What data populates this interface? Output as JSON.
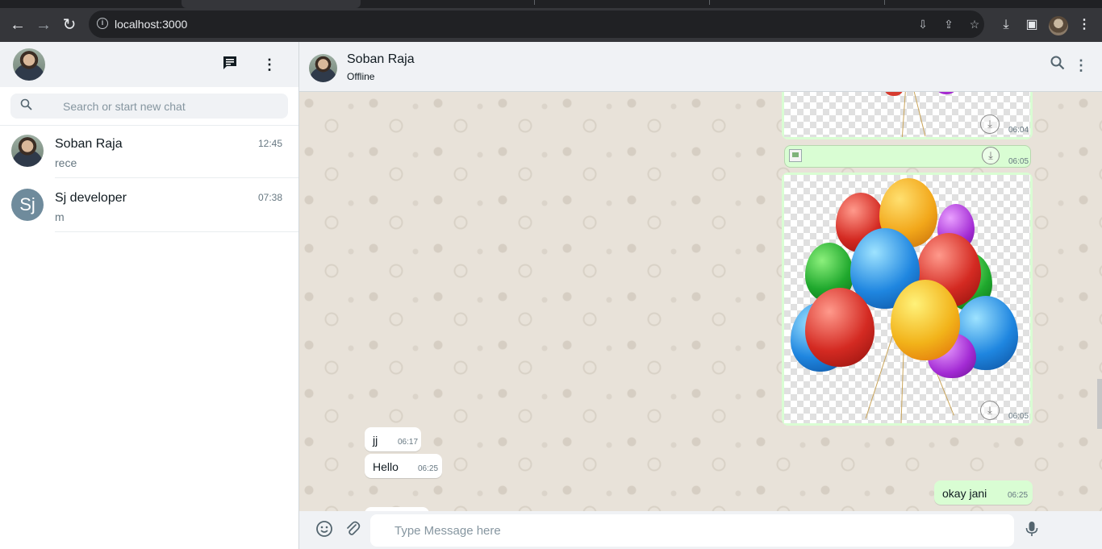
{
  "browser": {
    "url": "localhost:3000",
    "icons": [
      "back-icon",
      "forward-icon",
      "reload-icon",
      "info-icon",
      "install-icon",
      "share-icon",
      "star-icon",
      "download-icon",
      "sidepanel-icon",
      "menu-icon"
    ]
  },
  "sidebar": {
    "search_placeholder": "Search or start new chat",
    "chats": [
      {
        "name": "Soban Raja",
        "last": "rece",
        "time": "12:45"
      },
      {
        "name": "Sj developer",
        "last": "m",
        "time": "07:38",
        "initials": "Sj"
      }
    ]
  },
  "conversation": {
    "name": "Soban Raja",
    "status": "Offline",
    "messages": [
      {
        "direction": "out",
        "type": "image",
        "time": "06:04"
      },
      {
        "direction": "out",
        "type": "image-broken",
        "time": "06:05"
      },
      {
        "direction": "out",
        "type": "image",
        "time": "06:05"
      },
      {
        "direction": "in",
        "type": "text",
        "text": "jj",
        "time": "06:17"
      },
      {
        "direction": "in",
        "type": "text",
        "text": "Hello",
        "time": "06:25"
      },
      {
        "direction": "out",
        "type": "text",
        "text": "okay jani",
        "time": "06:25"
      }
    ],
    "input_placeholder": "Type Message here"
  },
  "colors": {
    "header_bg": "#f0f2f5",
    "out_bubble": "#d9fdd3",
    "in_bubble": "#ffffff",
    "chrome_bg": "#35363a"
  }
}
